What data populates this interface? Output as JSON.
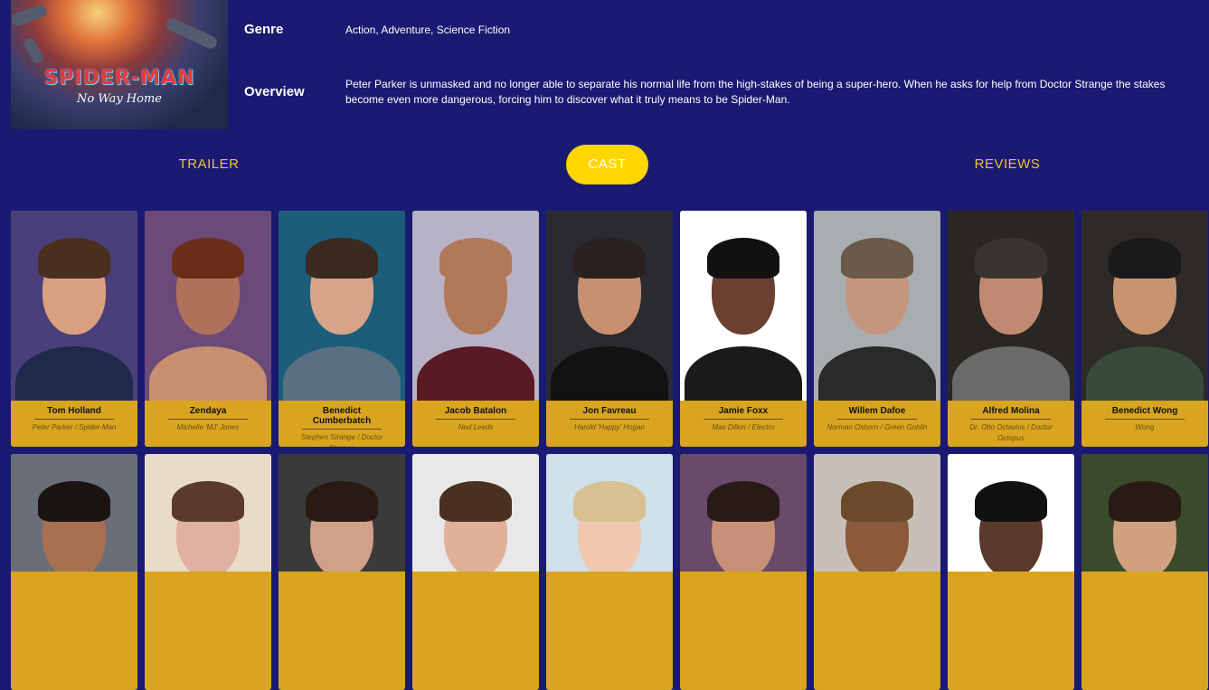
{
  "poster": {
    "title": "SPIDER-MAN",
    "subtitle": "No Way Home"
  },
  "details": {
    "genre_label": "Genre",
    "genre_value": "Action, Adventure, Science Fiction",
    "overview_label": "Overview",
    "overview_value": "Peter Parker is unmasked and no longer able to separate his normal life from the high-stakes of being a super-hero. When he asks for help from Doctor Strange the stakes become even more dangerous, forcing him to discover what it truly means to be Spider-Man."
  },
  "tabs": [
    {
      "label": "TRAILER",
      "active": false
    },
    {
      "label": "CAST",
      "active": true
    },
    {
      "label": "REVIEWS",
      "active": false
    }
  ],
  "cast": [
    {
      "name": "Tom Holland",
      "role": "Peter Parker / Spider-Man",
      "bg": "#4a3f78",
      "skin": "#d9a080",
      "hair": "#4a2e1e",
      "clothes": "#1f2a4a"
    },
    {
      "name": "Zendaya",
      "role": "Michelle 'MJ' Jones",
      "bg": "#6b4a7a",
      "skin": "#b0715a",
      "hair": "#6a2e1a",
      "clothes": "#c89070"
    },
    {
      "name": "Benedict Cumberbatch",
      "role": "Stephen Strange / Doctor Strange",
      "bg": "#1c5d7a",
      "skin": "#d7a48a",
      "hair": "#3a2a20",
      "clothes": "#587080"
    },
    {
      "name": "Jacob Batalon",
      "role": "Ned Leeds",
      "bg": "#b8b2c6",
      "skin": "#b07a5a",
      "hair": "#b07a5a",
      "clothes": "#5a1a24"
    },
    {
      "name": "Jon Favreau",
      "role": "Harold 'Happy' Hogan",
      "bg": "#2a2a30",
      "skin": "#c89070",
      "hair": "#2a2020",
      "clothes": "#121212"
    },
    {
      "name": "Jamie Foxx",
      "role": "Max Dillon / Electro",
      "bg": "#ffffff",
      "skin": "#6a4030",
      "hair": "#111111",
      "clothes": "#1a1a1a"
    },
    {
      "name": "Willem Dafoe",
      "role": "Norman Osborn / Green Goblin",
      "bg": "#a8aeb0",
      "skin": "#c49680",
      "hair": "#6a5a4a",
      "clothes": "#2a2a2a"
    },
    {
      "name": "Alfred Molina",
      "role": "Dr. Otto Octavius / Doctor Octopus",
      "bg": "#2a2622",
      "skin": "#c08a72",
      "hair": "#3a3430",
      "clothes": "#6a6a6a"
    },
    {
      "name": "Benedict Wong",
      "role": "Wong",
      "bg": "#2e2a28",
      "skin": "#c8946e",
      "hair": "#1a1a1a",
      "clothes": "#3a4a3a"
    }
  ],
  "cast_row2": [
    {
      "bg": "#6a6e78",
      "skin": "#a87050",
      "hair": "#1a1412",
      "clothes": "#2a2a2a"
    },
    {
      "bg": "#e8dcc8",
      "skin": "#e0b0a0",
      "hair": "#5a3a2a",
      "clothes": "#3a3a3a"
    },
    {
      "bg": "#3a3a3a",
      "skin": "#d0a088",
      "hair": "#2a1a14",
      "clothes": "#2a2a2a"
    },
    {
      "bg": "#e8e8e8",
      "skin": "#e0b098",
      "hair": "#4a3020",
      "clothes": "#dddddd"
    },
    {
      "bg": "#cfe0ea",
      "skin": "#f0c8b0",
      "hair": "#d8c090",
      "clothes": "#b0c0d0"
    },
    {
      "bg": "#6a4a6a",
      "skin": "#c89078",
      "hair": "#2a1a18",
      "clothes": "#2a2a2a"
    },
    {
      "bg": "#c8c0b8",
      "skin": "#8a5a3a",
      "hair": "#6a4a2a",
      "clothes": "#5a3a2a"
    },
    {
      "bg": "#ffffff",
      "skin": "#5a3a2a",
      "hair": "#111111",
      "clothes": "#2a2a2a"
    },
    {
      "bg": "#3a4a2a",
      "skin": "#d0a080",
      "hair": "#2a1a14",
      "clothes": "#2a2a2a"
    }
  ],
  "colors": {
    "background": "#1a1a72",
    "accent": "#ffd600",
    "tab_text": "#f2c230",
    "card": "#d9a521"
  }
}
